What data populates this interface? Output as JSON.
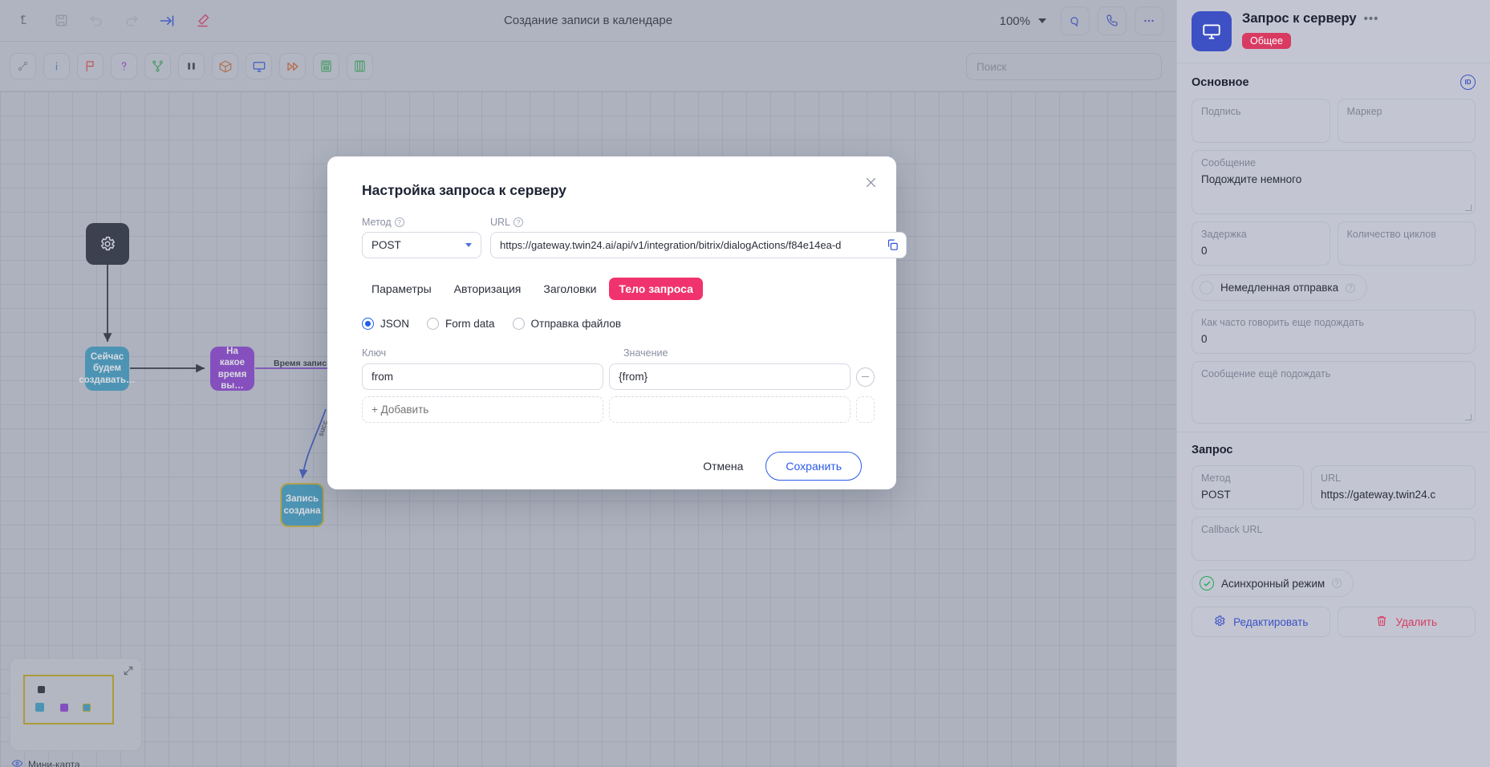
{
  "topbar": {
    "title": "Создание записи в календаре",
    "zoom": "100%",
    "icons": [
      "undo-arrow-icon",
      "save-icon",
      "undo-icon",
      "redo-icon",
      "arrow-to-line-icon",
      "eraser-icon"
    ],
    "right_icons": [
      "chat-icon",
      "phone-icon",
      "more-icon"
    ]
  },
  "toolbar2": {
    "icons": [
      "link-node-icon",
      "info-icon",
      "flag-icon",
      "question-icon",
      "branch-icon",
      "pause-icon",
      "cube-icon",
      "monitor-icon",
      "fast-forward-icon",
      "calculator-icon",
      "list-icon"
    ],
    "search_placeholder": "Поиск",
    "search_value": ""
  },
  "canvas": {
    "nodes": [
      {
        "id": "start",
        "label": "",
        "icon": "gear-icon"
      },
      {
        "id": "blue1",
        "label": "Сейчас будем создавать…"
      },
      {
        "id": "purple1",
        "label": "На какое время вы…"
      },
      {
        "id": "blue2",
        "label": "Запись создана"
      }
    ],
    "edge_labels": [
      "Время записи",
      "succ"
    ],
    "minimap_label": "Мини-карта",
    "minimap_icon": "eye-icon",
    "expand_icon": "expand-icon"
  },
  "modal": {
    "title": "Настройка запроса к серверу",
    "close_icon": "close-icon",
    "method_label": "Метод",
    "method_value": "POST",
    "url_label": "URL",
    "url_value": "https://gateway.twin24.ai/api/v1/integration/bitrix/dialogActions/f84e14ea-d",
    "copy_icon": "copy-icon",
    "tabs": [
      {
        "label": "Параметры",
        "active": false
      },
      {
        "label": "Авторизация",
        "active": false
      },
      {
        "label": "Заголовки",
        "active": false
      },
      {
        "label": "Тело запроса",
        "active": true
      }
    ],
    "body_types": [
      {
        "label": "JSON",
        "selected": true
      },
      {
        "label": "Form data",
        "selected": false
      },
      {
        "label": "Отправка файлов",
        "selected": false
      }
    ],
    "kv_head_key": "Ключ",
    "kv_head_value": "Значение",
    "kv_rows": [
      {
        "key": "from",
        "value": "{from}"
      }
    ],
    "add_placeholder": "+ Добавить",
    "new_value_placeholder": "",
    "cancel_label": "Отмена",
    "save_label": "Сохранить"
  },
  "rpanel": {
    "avatar_icon": "monitor-icon",
    "title": "Запрос к серверу",
    "more_icon": "more-icon",
    "badge": "Общее",
    "section_main": "Основное",
    "id_badge": "ID",
    "fields": {
      "signature_label": "Подпись",
      "signature_value": "",
      "marker_label": "Маркер",
      "marker_value": "",
      "message_label": "Сообщение",
      "message_value": "Подождите немного",
      "delay_label": "Задержка",
      "delay_value": "0",
      "cycles_label": "Количество циклов",
      "cycles_value": "",
      "immediate_label": "Немедленная отправка",
      "howoften_label": "Как часто говорить еще подождать",
      "howoften_value": "0",
      "wait_msg_label": "Сообщение ещё подождать",
      "wait_msg_value": ""
    },
    "section_request": "Запрос",
    "request": {
      "method_label": "Метод",
      "method_value": "POST",
      "url_label": "URL",
      "url_value": "https://gateway.twin24.c",
      "callback_label": "Callback URL",
      "callback_value": "",
      "async_label": "Асинхронный режим"
    },
    "actions": {
      "edit_label": "Редактировать",
      "edit_icon": "gear-icon",
      "delete_label": "Удалить",
      "delete_icon": "trash-icon"
    }
  }
}
